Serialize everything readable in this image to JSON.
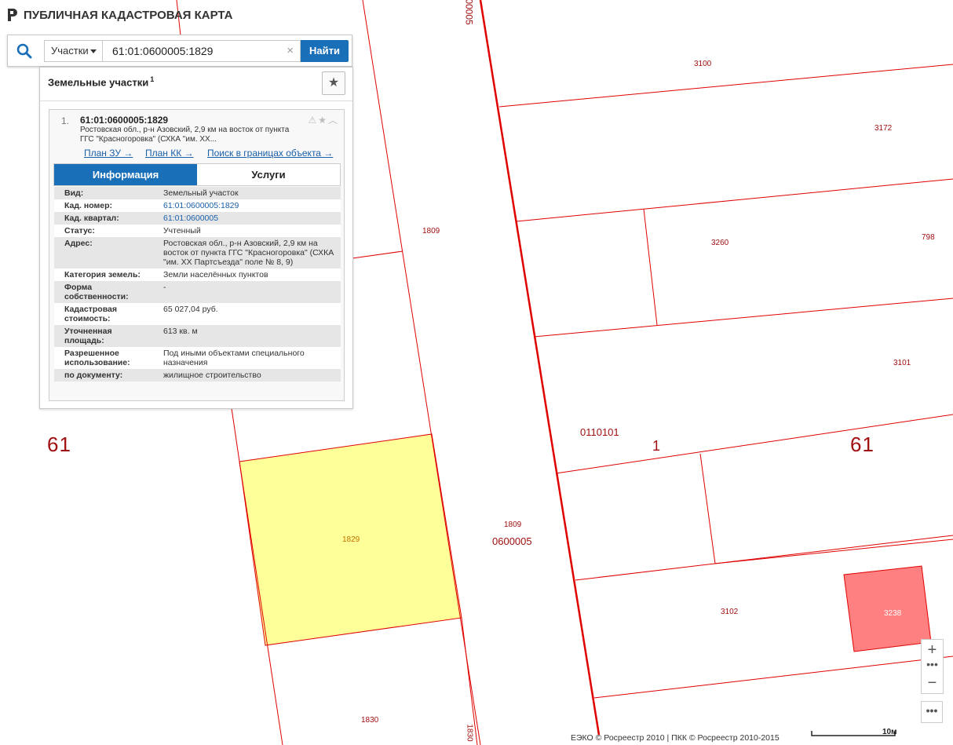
{
  "header": {
    "title": "ПУБЛИЧНАЯ КАДАСТРОВАЯ КАРТА"
  },
  "search": {
    "type_label": "Участки",
    "query": "61:01:0600005:1829",
    "clear": "×",
    "find_label": "Найти"
  },
  "results": {
    "heading": "Земельные участки",
    "count": "1",
    "item": {
      "index": "1.",
      "cadastral_number": "61:01:0600005:1829",
      "address_short": "Ростовская обл., р-н Азовский, 2,9 км на восток от пункта ГГС \"Красногоровка\" (СХКА \"им. ХХ...",
      "links": [
        "План ЗУ →",
        "План КК →",
        "Поиск в границах объекта →"
      ],
      "tabs": [
        "Информация",
        "Услуги"
      ],
      "properties": [
        {
          "key": "Вид:",
          "value": "Земельный участок"
        },
        {
          "key": "Кад. номер:",
          "value": "61:01:0600005:1829"
        },
        {
          "key": "Кад. квартал:",
          "value": "61:01:0600005"
        },
        {
          "key": "Статус:",
          "value": "Учтенный"
        },
        {
          "key": "Адрес:",
          "value": "Ростовская обл., р-н Азовский, 2,9 км на восток от пункта ГГС \"Красногоровка\" (СХКА \"им. ХХ Партсъезда\" поле № 8, 9)"
        },
        {
          "key": "Категория земель:",
          "value": "Земли населённых пунктов"
        },
        {
          "key": "Форма собственности:",
          "value": "-"
        },
        {
          "key": "Кадастровая стоимость:",
          "value": "65 027,04 руб."
        },
        {
          "key": "Уточненная площадь:",
          "value": "613 кв. м"
        },
        {
          "key": "Разрешенное использование:",
          "value": "Под иными объектами специального назначения"
        },
        {
          "key": "по документу:",
          "value": "жилищное строительство"
        }
      ]
    }
  },
  "map": {
    "line_color": "#e00000",
    "selected_fill": "#ffff99",
    "highlight_fill": "#ff8080",
    "labels": {
      "l3100": "3100",
      "l3172": "3172",
      "l1809a": "1809",
      "l3260": "3260",
      "l798": "798",
      "l3101": "3101",
      "l0110101": "0110101",
      "l1": "1",
      "l61a": "61",
      "l61b": "61",
      "l1829": "1829",
      "l1809b": "1809",
      "l0600005": "0600005",
      "l3102": "3102",
      "l3238": "3238",
      "l1830": "1830",
      "l1830v": "1830",
      "l0005": "00005"
    }
  },
  "controls": {
    "zoom_in": "+",
    "zoom_out": "−",
    "more": "•••",
    "zoom_more": "•••"
  },
  "footer": {
    "attribution": "ЕЭКО © Росреестр 2010 | ПКК © Росреестр 2010-2015",
    "scale": "10м"
  }
}
